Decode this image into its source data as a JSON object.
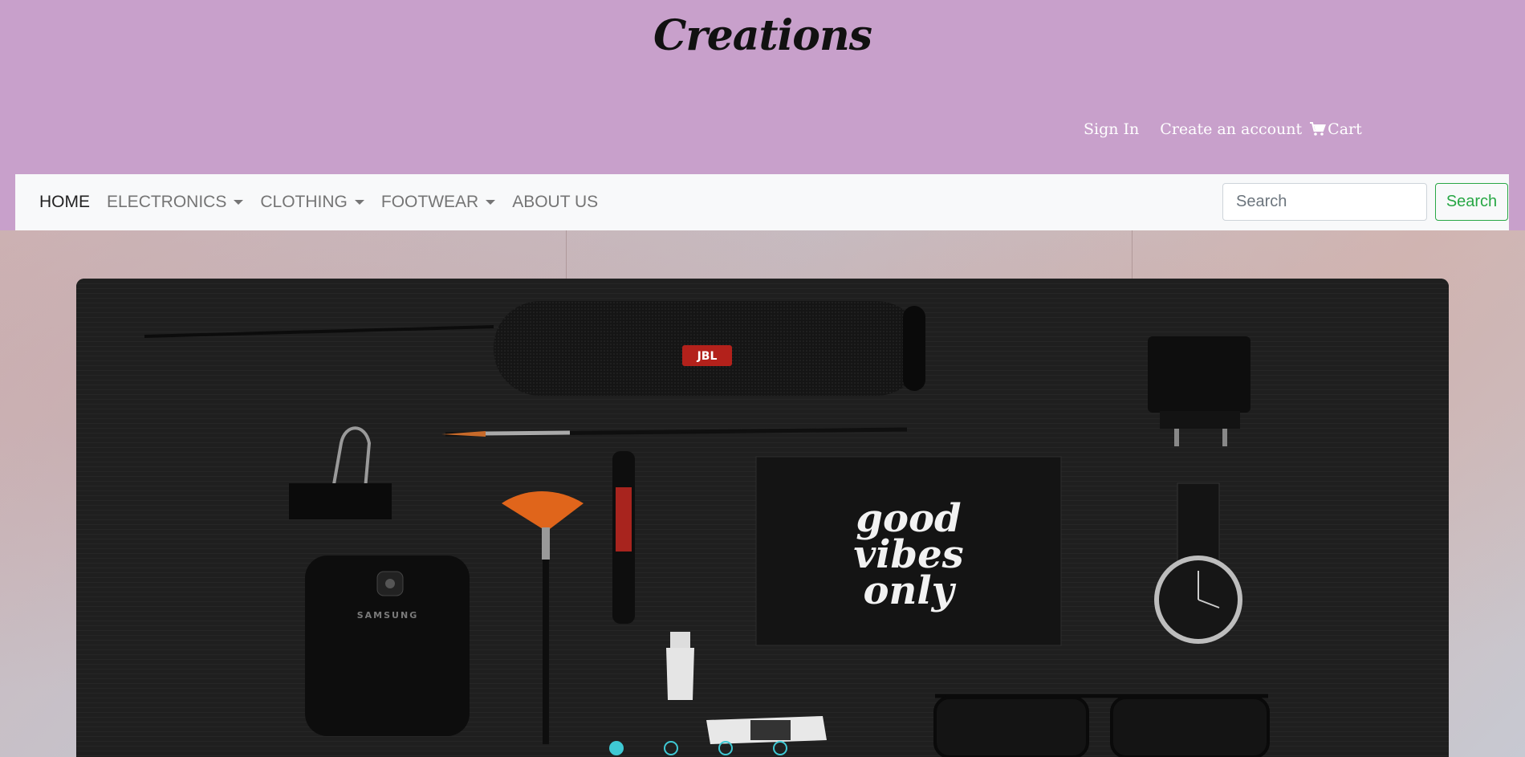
{
  "header": {
    "brand": "Creations",
    "links": {
      "signin": "Sign In",
      "create_account": "Create an account",
      "cart": "Cart"
    }
  },
  "nav": {
    "items": [
      {
        "label": "HOME",
        "active": true,
        "dropdown": false
      },
      {
        "label": "ELECTRONICS",
        "active": false,
        "dropdown": true
      },
      {
        "label": "CLOTHING",
        "active": false,
        "dropdown": true
      },
      {
        "label": "FOOTWEAR",
        "active": false,
        "dropdown": true
      },
      {
        "label": "ABOUT US",
        "active": false,
        "dropdown": false
      }
    ],
    "search": {
      "placeholder": "Search",
      "button_label": "Search"
    }
  },
  "carousel": {
    "slide_count": 4,
    "active_index": 0,
    "slide_texts": {
      "speaker_logo": "JBL",
      "phone_brand": "SAMSUNG",
      "card_line1": "good",
      "card_line2": "vibes",
      "card_line3": "only"
    }
  },
  "colors": {
    "header_bg": "#c8a0cb",
    "navbar_bg": "#f8f9fa",
    "search_accent": "#28a745",
    "indicator": "#3fc9d4"
  }
}
